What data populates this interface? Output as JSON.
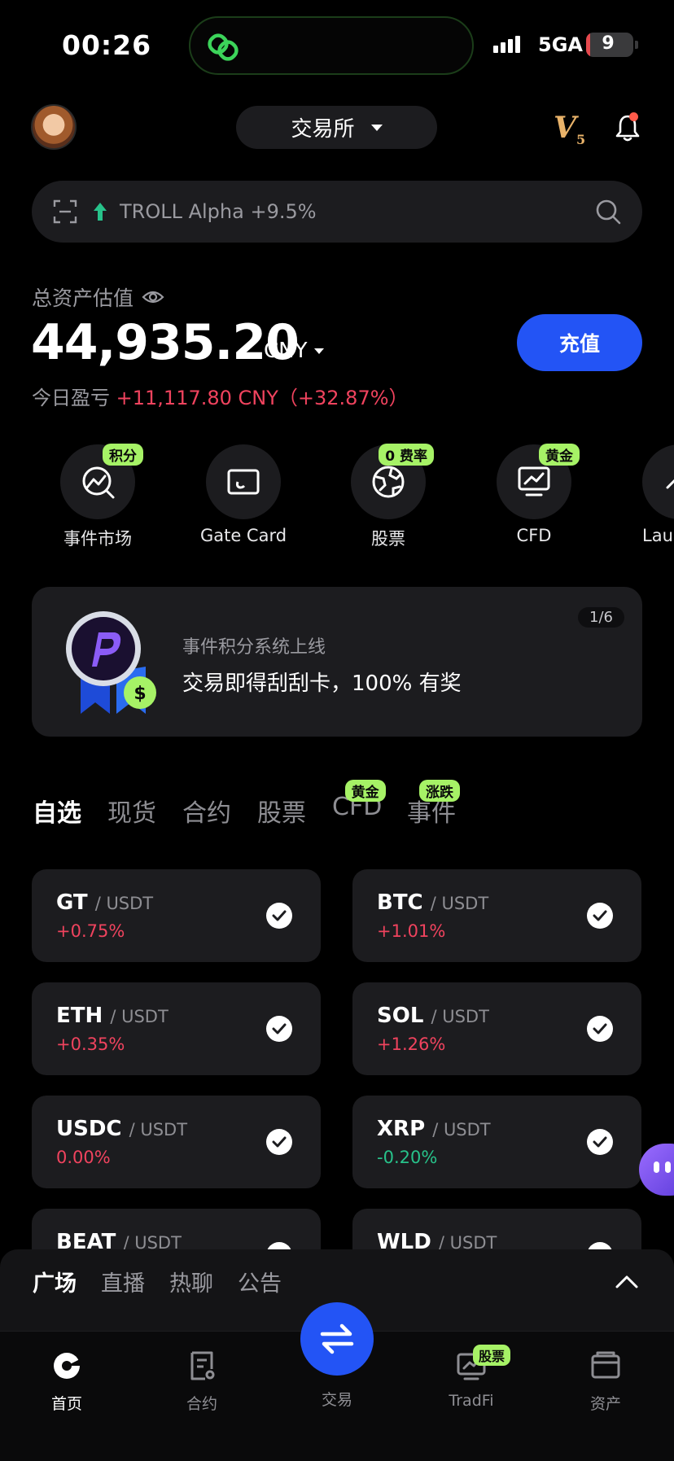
{
  "status_bar": {
    "time": "00:26",
    "network": "5GA",
    "battery": "9",
    "battery_level_percent": 9
  },
  "header": {
    "exchange_label": "交易所",
    "vip_level": "V",
    "vip_sub": "5"
  },
  "search": {
    "trending_text": "TROLL Alpha +9.5%"
  },
  "assets": {
    "label": "总资产估值",
    "value": "44,935.20",
    "currency": "CNY",
    "pnl_label": "今日盈亏",
    "pnl_value": "+11,117.80 CNY（+32.87%）",
    "deposit_label": "充值"
  },
  "quick_entries": [
    {
      "label": "事件市场",
      "badge": "积分",
      "icon": "chart-search-icon"
    },
    {
      "label": "Gate Card",
      "badge": "",
      "icon": "card-icon"
    },
    {
      "label": "股票",
      "badge": "0 费率",
      "icon": "globe-icon"
    },
    {
      "label": "CFD",
      "badge": "黄金",
      "icon": "monitor-chart-icon"
    },
    {
      "label": "Launc",
      "badge": "",
      "icon": "rocket-icon"
    }
  ],
  "banner": {
    "title": "事件积分系统上线",
    "subtitle": "交易即得刮刮卡，100% 有奖",
    "page": "1/6"
  },
  "market_tabs": [
    {
      "label": "自选",
      "badge": ""
    },
    {
      "label": "现货",
      "badge": ""
    },
    {
      "label": "合约",
      "badge": ""
    },
    {
      "label": "股票",
      "badge": ""
    },
    {
      "label": "CFD",
      "badge": "黄金"
    },
    {
      "label": "事件",
      "badge": "涨跌"
    }
  ],
  "pairs": [
    {
      "base": "GT",
      "quote": "/ USDT",
      "change": "+0.75%",
      "dir": "up"
    },
    {
      "base": "BTC",
      "quote": "/ USDT",
      "change": "+1.01%",
      "dir": "up"
    },
    {
      "base": "ETH",
      "quote": "/ USDT",
      "change": "+0.35%",
      "dir": "up"
    },
    {
      "base": "SOL",
      "quote": "/ USDT",
      "change": "+1.26%",
      "dir": "up"
    },
    {
      "base": "USDC",
      "quote": "/ USDT",
      "change": "0.00%",
      "dir": "up"
    },
    {
      "base": "XRP",
      "quote": "/ USDT",
      "change": "-0.20%",
      "dir": "down"
    },
    {
      "base": "BEAT",
      "quote": "/ USDT",
      "change": "",
      "dir": "up"
    },
    {
      "base": "WLD",
      "quote": "/ USDT",
      "change": "",
      "dir": "up"
    }
  ],
  "community_tabs": [
    "广场",
    "直播",
    "热聊",
    "公告"
  ],
  "bottom_nav": {
    "home": "首页",
    "futures": "合约",
    "trade": "交易",
    "tradfi": "TradFi",
    "tradfi_badge": "股票",
    "assets": "资产"
  },
  "colors": {
    "accent": "#2354f5",
    "up": "#f0435e",
    "down": "#27c28a",
    "badge": "#a6f266"
  }
}
